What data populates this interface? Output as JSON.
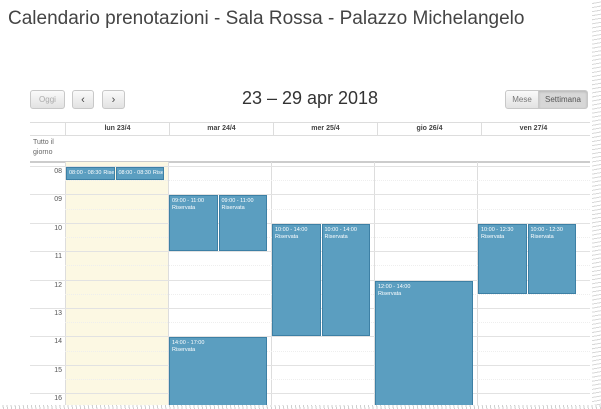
{
  "page_title": "Calendario prenotazioni - Sala Rossa - Palazzo Michelangelo",
  "toolbar": {
    "today_label": "Oggi",
    "prev_icon": "chevron-left-icon",
    "prev_glyph": "‹",
    "next_icon": "chevron-right-icon",
    "next_glyph": "›",
    "week_range": "23 – 29 apr 2018",
    "month_label": "Mese",
    "week_label": "Settimana"
  },
  "calendar": {
    "allday_label": "Tutto il giorno",
    "days": [
      "lun 23/4",
      "mar 24/4",
      "mer 25/4",
      "gio 26/4",
      "ven 27/4"
    ],
    "today_index": 0,
    "hours": [
      "08",
      "09",
      "10",
      "11",
      "12",
      "13",
      "14",
      "15",
      "16"
    ],
    "first_hour": 8,
    "events": [
      {
        "day": 0,
        "start": 8.0,
        "end": 8.5,
        "time": "08:00 - 08:30",
        "title": "Riservat",
        "short": true,
        "lane": 0,
        "lanes": 2
      },
      {
        "day": 0,
        "start": 8.0,
        "end": 8.5,
        "time": "08:00 - 08:30",
        "title": "Riservat",
        "short": true,
        "lane": 1,
        "lanes": 2
      },
      {
        "day": 1,
        "start": 9.0,
        "end": 11.0,
        "time": "09:00 - 11:00",
        "title": "Riservata",
        "lane": 0,
        "lanes": 2
      },
      {
        "day": 1,
        "start": 9.0,
        "end": 11.0,
        "time": "09:00 - 11:00",
        "title": "Riservata",
        "lane": 1,
        "lanes": 2
      },
      {
        "day": 2,
        "start": 10.0,
        "end": 14.0,
        "time": "10:00 - 14:00",
        "title": "Riservata",
        "lane": 0,
        "lanes": 2
      },
      {
        "day": 2,
        "start": 10.0,
        "end": 14.0,
        "time": "10:00 - 14:00",
        "title": "Riservata",
        "lane": 1,
        "lanes": 2
      },
      {
        "day": 4,
        "start": 10.0,
        "end": 12.5,
        "time": "10:00 - 12:30",
        "title": "Riservata",
        "lane": 0,
        "lanes": 2
      },
      {
        "day": 4,
        "start": 10.0,
        "end": 12.5,
        "time": "10:00 - 12:30",
        "title": "Riservata",
        "lane": 1,
        "lanes": 2
      },
      {
        "day": 3,
        "start": 12.0,
        "end": 17.0,
        "time": "12:00 - 14:00",
        "title": "Riservata",
        "lane": 0,
        "lanes": 1
      },
      {
        "day": 1,
        "start": 14.0,
        "end": 17.0,
        "time": "14:00 - 17:00",
        "title": "Riservata",
        "lane": 0,
        "lanes": 1
      }
    ]
  },
  "colors": {
    "event_bg": "#5b9ec0",
    "event_border": "#3d80a5",
    "today_bg": "#fcf8e3"
  }
}
